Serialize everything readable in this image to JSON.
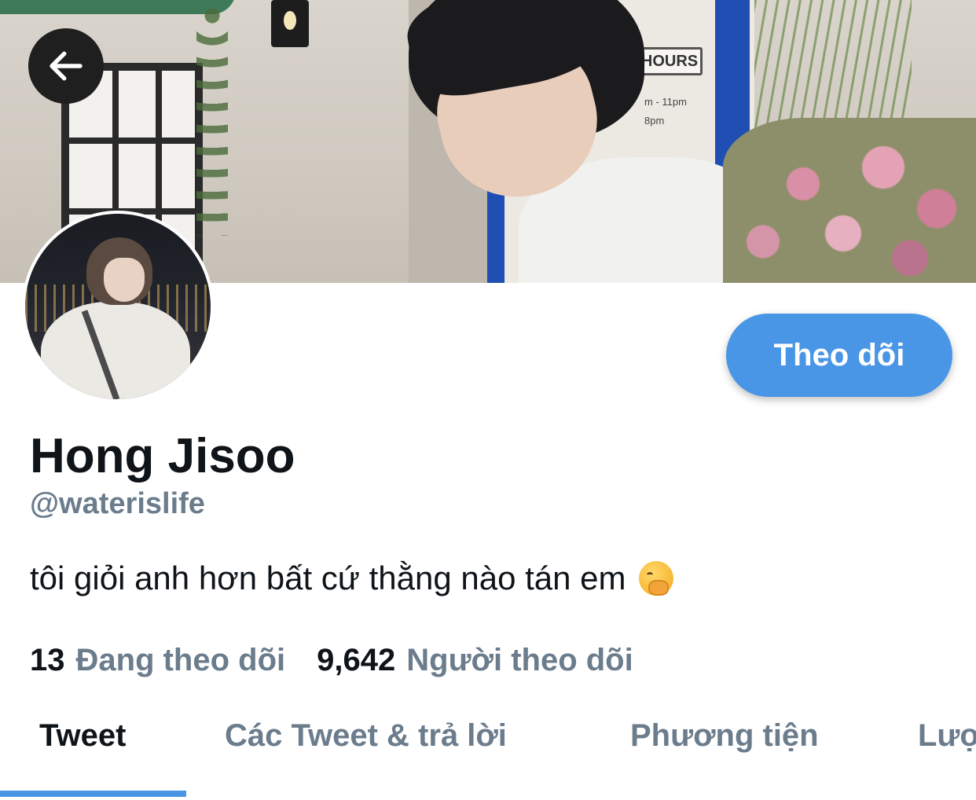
{
  "header": {
    "back_icon": "arrow-left-icon"
  },
  "banner": {
    "sign_text": "HOURS",
    "hours_line1": "m - 11pm",
    "hours_line2": "8pm"
  },
  "profile": {
    "display_name": "Hong Jisoo",
    "handle": "@waterislife",
    "bio": "tôi giỏi anh hơn bất cứ thằng nào tán em",
    "bio_emoji": "yawning-face-icon",
    "follow_label": "Theo dõi",
    "following_count": "13",
    "following_label": "Đang theo dõi",
    "followers_count": "9,642",
    "followers_label": "Người theo dõi"
  },
  "tabs": [
    {
      "label": "Tweet",
      "active": true
    },
    {
      "label": "Các Tweet & trả lời",
      "active": false
    },
    {
      "label": "Phương tiện",
      "active": false
    },
    {
      "label": "Lượt thích",
      "active": false
    }
  ],
  "colors": {
    "accent": "#4a96e6",
    "text_primary": "#0f1419",
    "text_secondary": "#6b7c8c"
  }
}
